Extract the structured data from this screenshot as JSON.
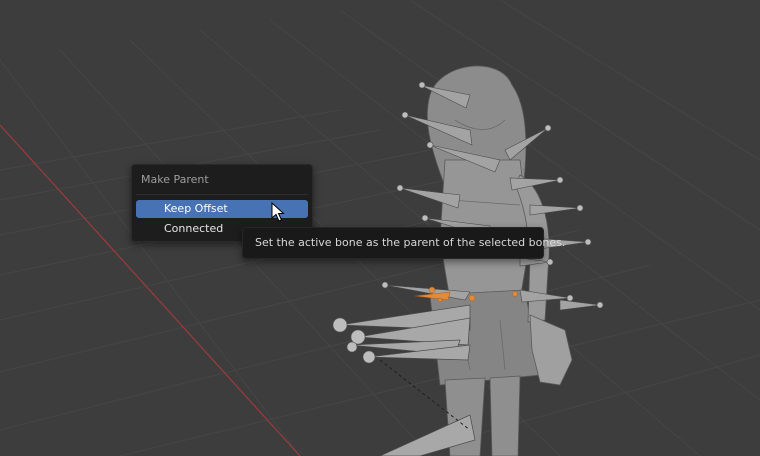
{
  "menu": {
    "title": "Make Parent",
    "items": [
      {
        "label": "Keep Offset",
        "active": true
      },
      {
        "label": "Connected",
        "active": false
      }
    ]
  },
  "tooltip": {
    "text": "Set the active bone as the parent of the selected bones."
  },
  "icons": {
    "cursor": "mouse-pointer-icon"
  },
  "colors": {
    "viewport_bg": "#3d3d3d",
    "grid_line": "#474747",
    "x_axis": "#9c3b3b",
    "menu_bg": "#1d1d1d",
    "menu_highlight": "#4772b3",
    "model_gray": "#8e8e8e",
    "bone_gray": "#9a9a9a",
    "bone_selected": "#e08a3a"
  }
}
